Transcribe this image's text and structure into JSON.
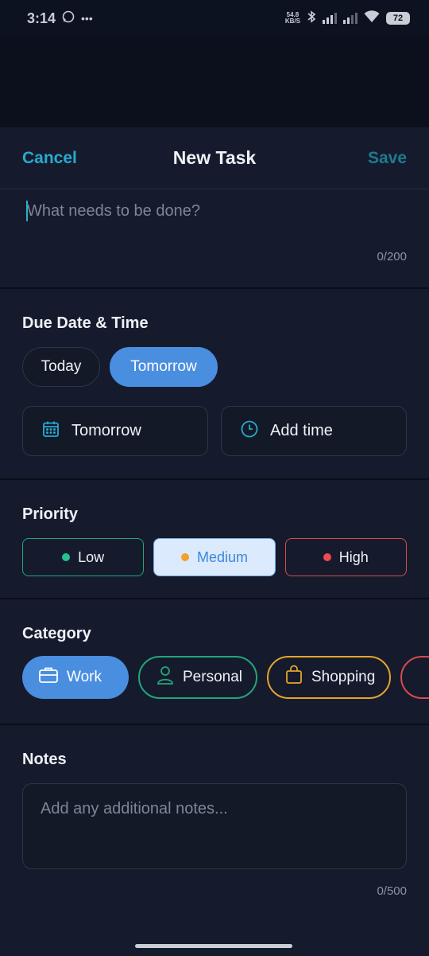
{
  "status_bar": {
    "time": "3:14",
    "speed_value": "54.8",
    "speed_unit": "KB/S",
    "battery": "72"
  },
  "header": {
    "cancel_label": "Cancel",
    "title": "New Task",
    "save_label": "Save"
  },
  "task": {
    "placeholder": "What needs to be done?",
    "value": "",
    "counter": "0/200"
  },
  "due": {
    "title": "Due Date & Time",
    "quick_options": [
      "Today",
      "Tomorrow"
    ],
    "selected_quick": "Tomorrow",
    "date_label": "Tomorrow",
    "time_label": "Add time"
  },
  "priority": {
    "title": "Priority",
    "options": [
      {
        "label": "Low",
        "color": "#22c38e"
      },
      {
        "label": "Medium",
        "color": "#f2a12b"
      },
      {
        "label": "High",
        "color": "#ee4a52"
      }
    ],
    "selected": "Medium"
  },
  "category": {
    "title": "Category",
    "options": [
      {
        "label": "Work",
        "icon": "briefcase-icon"
      },
      {
        "label": "Personal",
        "icon": "person-icon"
      },
      {
        "label": "Shopping",
        "icon": "shopping-bag-icon"
      }
    ],
    "selected": "Work"
  },
  "notes": {
    "title": "Notes",
    "placeholder": "Add any additional notes...",
    "value": "",
    "counter": "0/500"
  },
  "colors": {
    "accent": "#4a8ee0",
    "cancel": "#29a9cf",
    "background": "#151b2c"
  }
}
